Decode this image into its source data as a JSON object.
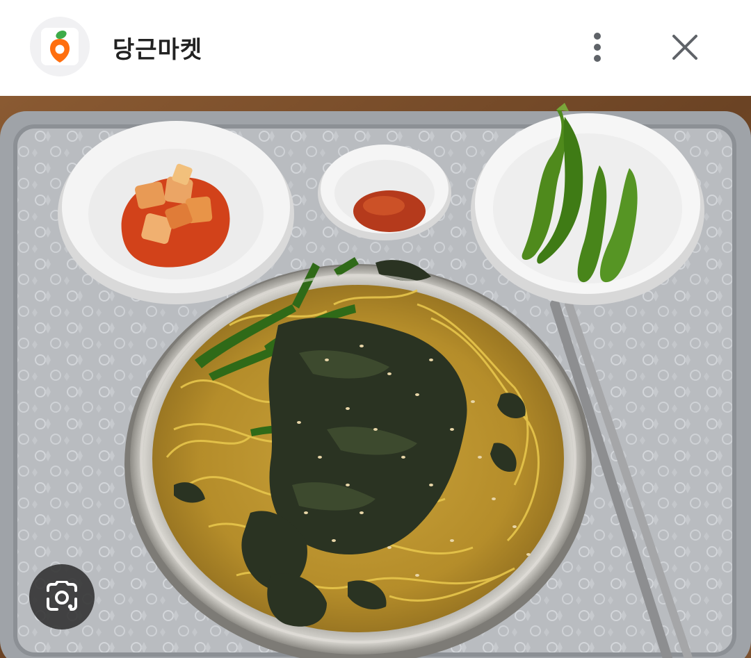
{
  "header": {
    "app_name": "당근마켓",
    "logo_icon": "carrot-logo-icon",
    "more_icon": "more-vertical-icon",
    "close_icon": "close-icon"
  },
  "image": {
    "lens_icon": "lens-search-icon"
  },
  "colors": {
    "logo_orange": "#ff6f0f",
    "logo_green": "#3dab49",
    "icon_gray": "#5f6368"
  }
}
